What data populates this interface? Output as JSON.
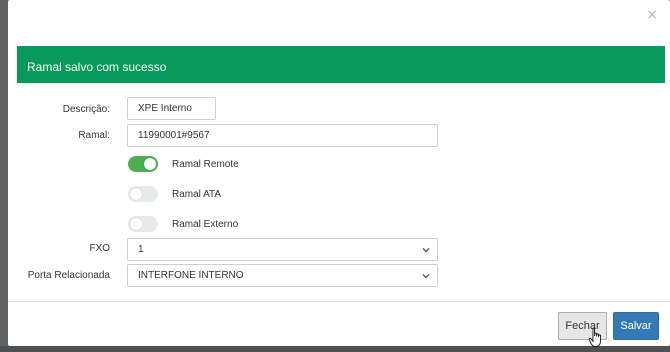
{
  "modal": {
    "close_icon": "×",
    "alert_message": "Ramal salvo com sucesso"
  },
  "form": {
    "descricao": {
      "label": "Descrição:",
      "value": "XPE Interno"
    },
    "ramal": {
      "label": "Ramal:",
      "value": "11990001#9567"
    },
    "toggles": [
      {
        "label": "Ramal Remote",
        "on": true
      },
      {
        "label": "Ramal ATA",
        "on": false
      },
      {
        "label": "Ramal Externo",
        "on": false
      }
    ],
    "fxo": {
      "label": "FXO",
      "value": "1"
    },
    "porta": {
      "label": "Porta Relacionada",
      "value": "INTERFONE INTERNO"
    }
  },
  "footer": {
    "fechar_label": "Fechar",
    "salvar_label": "Salvar"
  },
  "colors": {
    "alert_bg": "#079a5b",
    "toggle_on": "#4caf50",
    "primary_button": "#337ab7"
  }
}
